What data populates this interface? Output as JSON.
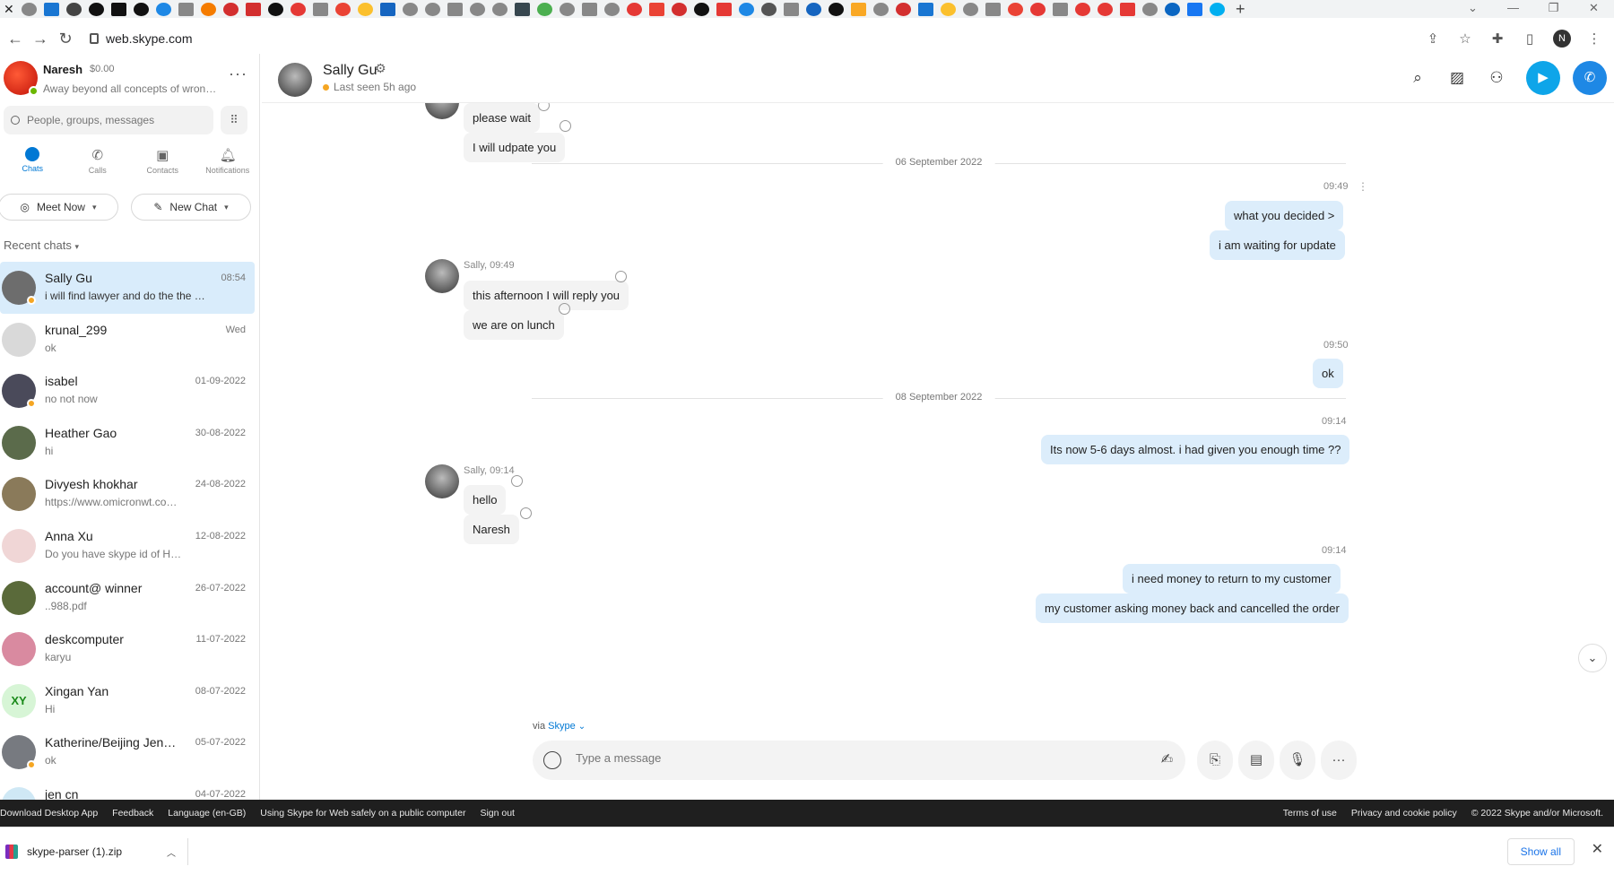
{
  "browser": {
    "url": "web.skype.com",
    "profile_initial": "N",
    "tab_icon_colors": [
      "#888",
      "#1976d2",
      "#444",
      "#111",
      "#111",
      "#111",
      "#1e88e5",
      "#888",
      "#f57c00",
      "#d32f2f",
      "#d32f2f",
      "#111",
      "#e53935",
      "#888",
      "#ea4335",
      "#fbc02d",
      "#1565c0",
      "#888",
      "#888",
      "#888",
      "#888",
      "#888",
      "#37474f",
      "#4caf50",
      "#888",
      "#888",
      "#888",
      "#e53935",
      "#ea4335",
      "#d32f2f",
      "#111",
      "#e53935",
      "#1e88e5",
      "#555",
      "#888",
      "#1565c0",
      "#111",
      "#f9a825",
      "#888",
      "#d32f2f",
      "#1976d2",
      "#fbc02d",
      "#888",
      "#888",
      "#ea4335",
      "#e53935",
      "#888",
      "#e53935",
      "#e53935",
      "#e53935",
      "#888",
      "#0a66c2",
      "#1877f2",
      "#00aff0"
    ]
  },
  "me": {
    "name": "Naresh",
    "credit": "$0.00",
    "mood": "Away beyond all concepts of wron…"
  },
  "search": {
    "placeholder": "People, groups, messages"
  },
  "nav": {
    "chats": "Chats",
    "calls": "Calls",
    "contacts": "Contacts",
    "notifications": "Notifications"
  },
  "actions": {
    "meet_now": "Meet Now",
    "new_chat": "New Chat"
  },
  "recent_heading": "Recent chats",
  "chats": [
    {
      "name": "Sally Gu",
      "preview": "i will find lawyer and do the the …",
      "time": "08:54",
      "color": "#6d6d6d",
      "presence": true
    },
    {
      "name": "krunal_299",
      "preview": "ok",
      "time": "Wed",
      "color": "#d9d9d9",
      "presence": false
    },
    {
      "name": "isabel",
      "preview": "no not now",
      "time": "01-09-2022",
      "color": "#4a4a5a",
      "presence": true
    },
    {
      "name": "Heather Gao",
      "preview": "hi",
      "time": "30-08-2022",
      "color": "#5b6b4b",
      "presence": false
    },
    {
      "name": "Divyesh khokhar",
      "preview": "https://www.omicronwt.co…",
      "time": "24-08-2022",
      "color": "#8a7a5a",
      "presence": false
    },
    {
      "name": "Anna Xu",
      "preview": "Do you have skype id of H…",
      "time": "12-08-2022",
      "color": "#f0d6d6",
      "presence": false
    },
    {
      "name": "account@ winner",
      "preview": "..988.pdf",
      "time": "26-07-2022",
      "color": "#5a6a3a",
      "presence": false
    },
    {
      "name": "deskcomputer",
      "preview": "karyu",
      "time": "11-07-2022",
      "color": "#d98aa0",
      "presence": false
    },
    {
      "name": "Xingan  Yan",
      "preview": "Hi",
      "time": "08-07-2022",
      "color": "#d7f5d6",
      "presence": false,
      "initials": "XY"
    },
    {
      "name": "Katherine/Beijing Jen…",
      "preview": "ok",
      "time": "05-07-2022",
      "color": "#777a80",
      "presence": true
    },
    {
      "name": "jen cn",
      "preview": "",
      "time": "04-07-2022",
      "color": "#cfe8f5",
      "presence": false
    }
  ],
  "conversation": {
    "name": "Sally Gu",
    "status": "Last seen 5h ago",
    "messages": {
      "m1": "please wait",
      "m2": "I will udpate you",
      "d1": "06 September 2022",
      "t1": "09:49",
      "m3": "what you decided >",
      "m4": "i am waiting for update",
      "s1": "Sally, 09:49",
      "m5": "this afternoon I will reply you",
      "m6": "we are on lunch",
      "t2": "09:50",
      "m7": "ok",
      "d2": "08 September 2022",
      "t3": "09:14",
      "m8": "Its now 5-6 days almost. i had given you enough time ??",
      "s2": "Sally, 09:14",
      "m9": "hello",
      "m10": "Naresh",
      "t4": "09:14",
      "m11": "i need money  to return to my customer",
      "m12": "my customer asking money back and cancelled the order"
    },
    "via_prefix": "via",
    "via_link": "Skype",
    "composer_placeholder": "Type a message"
  },
  "footer": {
    "left": [
      "Download Desktop App",
      "Feedback",
      "Language (en-GB)",
      "Using Skype for Web safely on a public computer",
      "Sign out"
    ],
    "right": [
      "Terms of use",
      "Privacy and cookie policy",
      "© 2022 Skype and/or Microsoft."
    ]
  },
  "download": {
    "filename": "skype-parser (1).zip",
    "show_all": "Show all"
  }
}
